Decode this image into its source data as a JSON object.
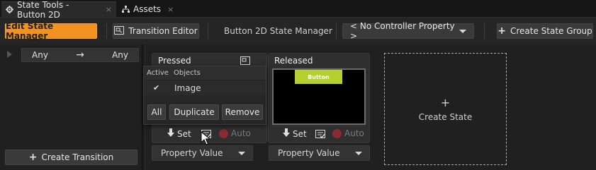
{
  "tabs": [
    {
      "label": "State Tools - Button 2D",
      "close": "×"
    },
    {
      "label": "Assets",
      "close": "×"
    }
  ],
  "toolbar": {
    "edit_state_manager": "Edit State Manager",
    "transition_editor": "Transition Editor",
    "state_manager_name": "Button 2D State Manager",
    "controller_property": "< No Controller Property >",
    "create_state_group": "Create State Group",
    "plus": "+"
  },
  "transitions": {
    "from": "Any",
    "arrow": "→",
    "to": "Any",
    "create_transition": "Create Transition",
    "plus": "+"
  },
  "states": [
    {
      "title": "Pressed",
      "set": "Set",
      "auto": "Auto",
      "property_value": "Property Value"
    },
    {
      "title": "Released",
      "preview_button": "Button",
      "set": "Set",
      "auto": "Auto",
      "property_value": "Property Value"
    }
  ],
  "create_state": {
    "label": "Create State",
    "plus": "+"
  },
  "popup": {
    "col_active": "Active",
    "col_objects": "Objects",
    "items": [
      {
        "checked": "✔",
        "name": "Image"
      }
    ],
    "buttons": {
      "all": "All",
      "duplicate": "Duplicate",
      "remove": "Remove"
    }
  },
  "colors": {
    "accent": "#f29221",
    "preview_button": "#b5cf2e",
    "record": "#8a2a31"
  }
}
